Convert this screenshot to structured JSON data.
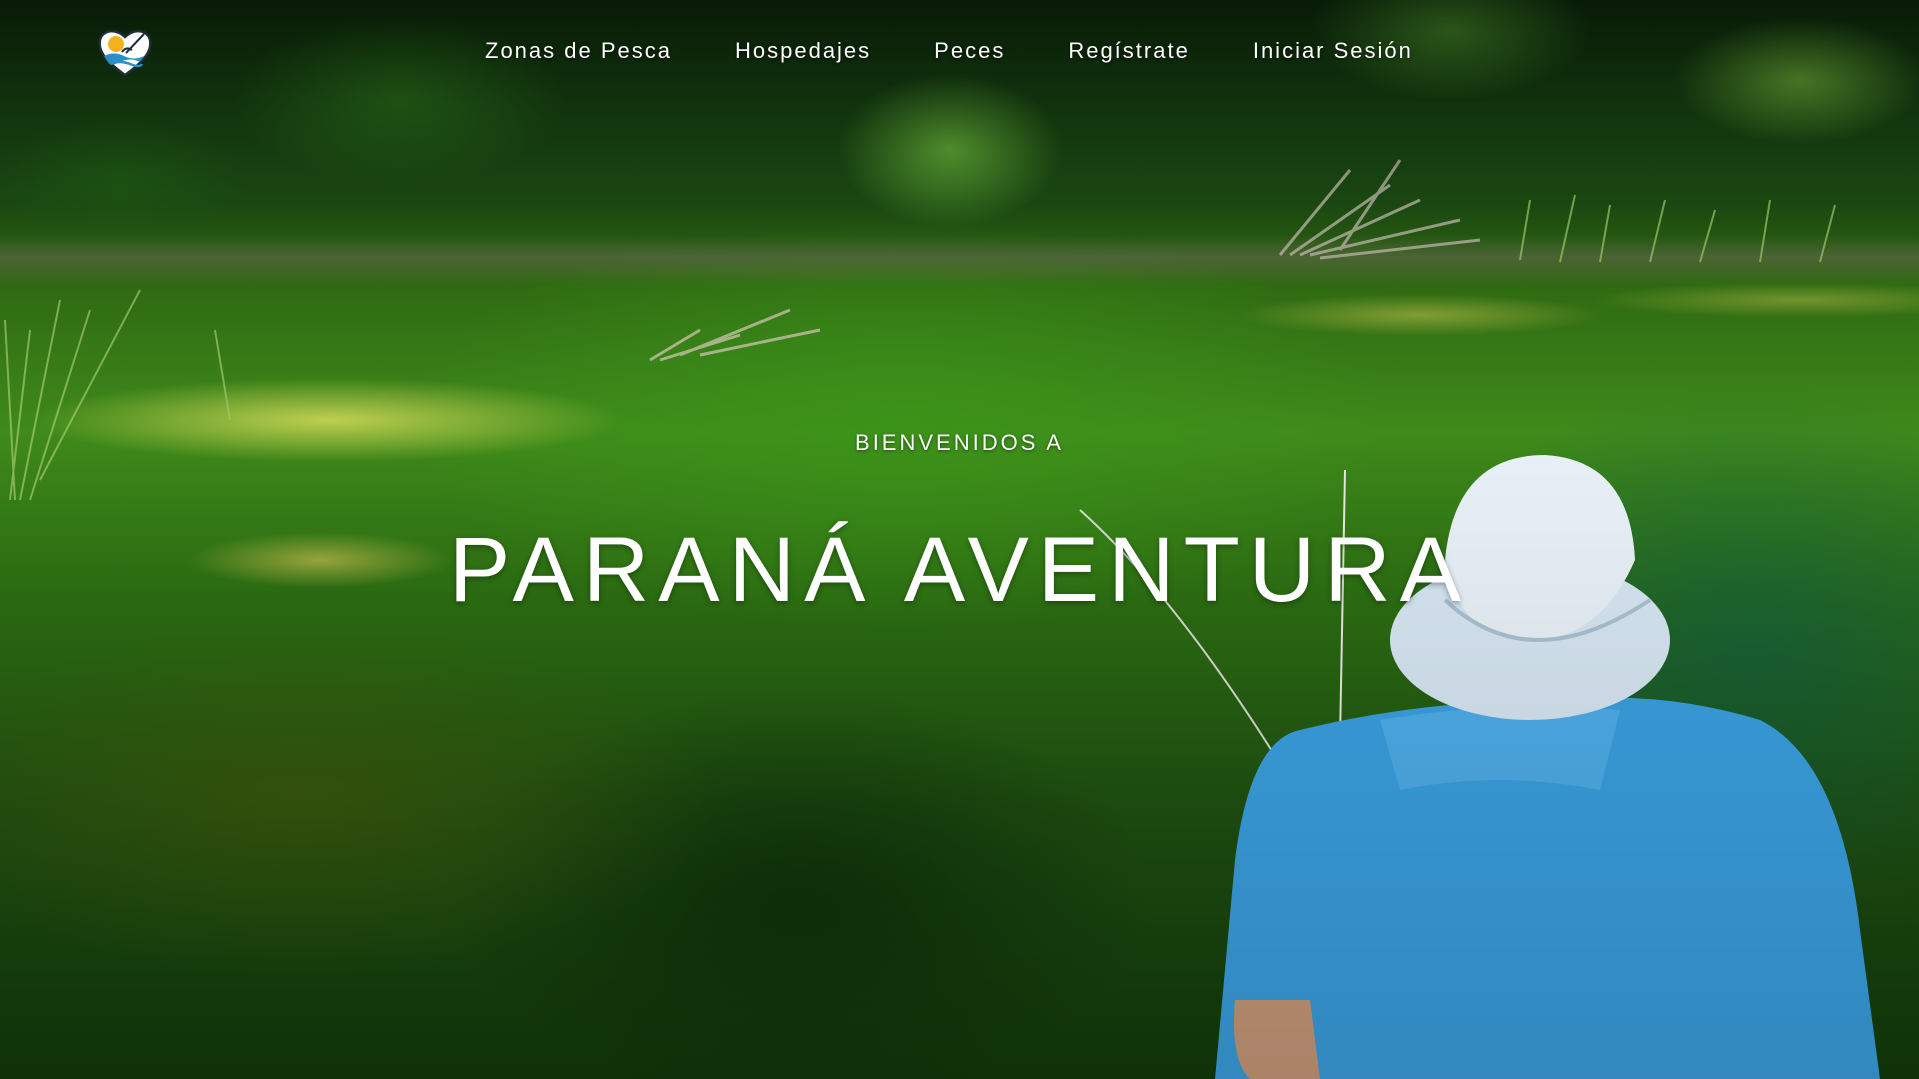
{
  "brand": {
    "logo_icon": "heart-fishing-logo-icon",
    "colors": {
      "sun": "#f2b21c",
      "wave": "#2a8fc7",
      "outline": "#1d2d3a"
    }
  },
  "nav": {
    "items": [
      {
        "label": "Zonas de Pesca"
      },
      {
        "label": "Hospedajes"
      },
      {
        "label": "Peces"
      },
      {
        "label": "Regístrate"
      },
      {
        "label": "Iniciar Sesión"
      }
    ]
  },
  "hero": {
    "subtitle": "BIENVENIDOS A",
    "title": "PARANÁ AVENTURA",
    "background": "river-fishing-scene",
    "colors": {
      "water": "#2f7a14",
      "trees": "#153e10",
      "shirt": "#3aa0e0",
      "hat": "#d6e6f2"
    }
  }
}
